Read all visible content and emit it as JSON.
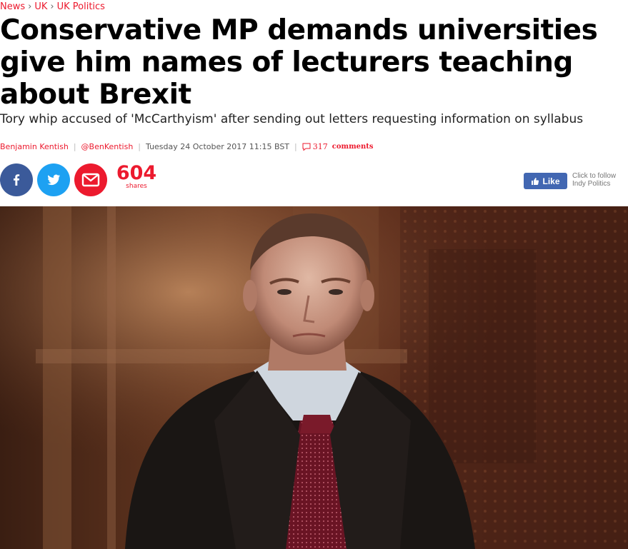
{
  "breadcrumb": [
    {
      "label": "News"
    },
    {
      "label": "UK"
    },
    {
      "label": "UK Politics"
    }
  ],
  "breadcrumb_separator": "›",
  "headline": {
    "line1": "Conservative MP demands universities",
    "line2": "give him names of lecturers teaching",
    "line3": "about Brexit"
  },
  "standfirst": "Tory whip accused of 'McCarthyism' after sending out letters requesting information on syllabus",
  "byline": {
    "author": "Benjamin Kentish",
    "twitter": "@BenKentish",
    "date": "Tuesday 24 October 2017 11:15 BST",
    "comments_count": "317",
    "comments_label": "comments"
  },
  "share": {
    "count": "604",
    "label": "shares"
  },
  "facebook": {
    "like_label": "Like",
    "follow_line1": "Click to follow",
    "follow_line2": "Indy Politics"
  },
  "colors": {
    "accent": "#ec1a2e",
    "facebook": "#3b5a9a",
    "twitter": "#1da1f2",
    "like": "#4267b2"
  }
}
